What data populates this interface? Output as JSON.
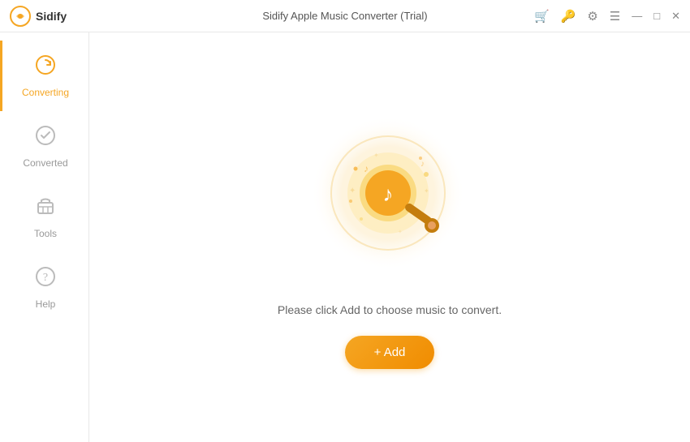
{
  "titleBar": {
    "logo": "Sidify",
    "title": "Sidify Apple Music Converter (Trial)",
    "icons": {
      "cart": "🛒",
      "key": "🔑",
      "settings": "⚙",
      "menu": "☰",
      "minimize": "—",
      "maximize": "□",
      "close": "✕"
    }
  },
  "sidebar": {
    "items": [
      {
        "id": "converting",
        "label": "Converting",
        "active": true
      },
      {
        "id": "converted",
        "label": "Converted",
        "active": false
      },
      {
        "id": "tools",
        "label": "Tools",
        "active": false
      },
      {
        "id": "help",
        "label": "Help",
        "active": false
      }
    ]
  },
  "main": {
    "prompt": "Please click Add to choose music to convert.",
    "addButton": "+ Add"
  },
  "colors": {
    "accent": "#f5a623",
    "accentDark": "#c47d0e",
    "sidebar_active_border": "#f5a623"
  }
}
